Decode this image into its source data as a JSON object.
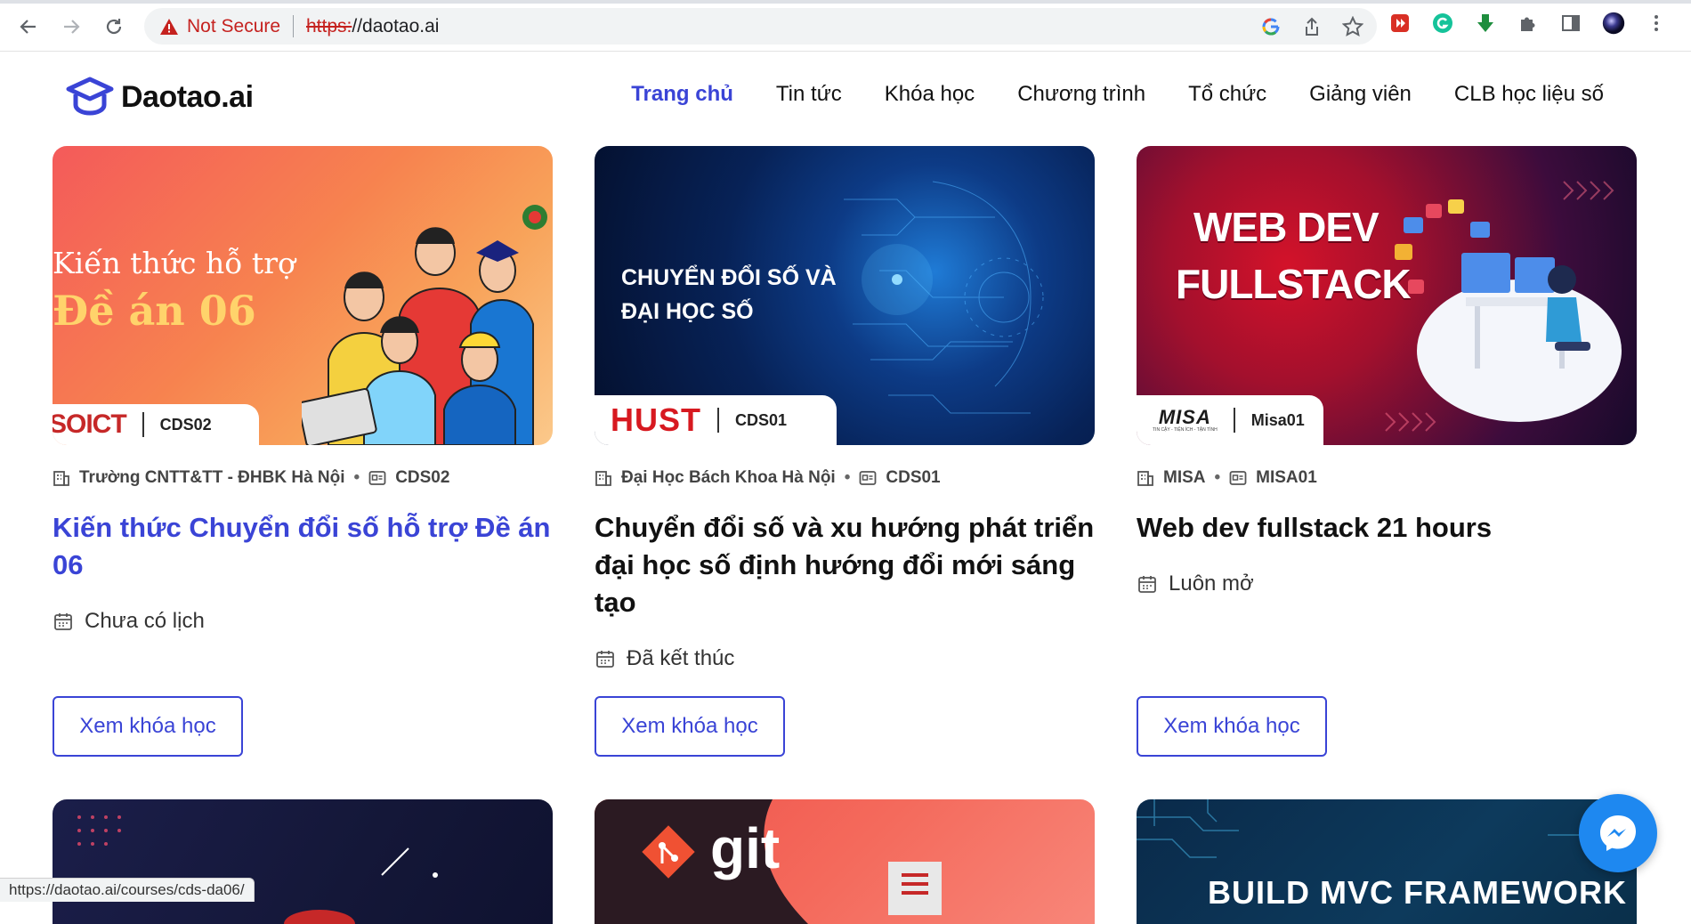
{
  "browser": {
    "security_label": "Not Secure",
    "url_scheme": "https:",
    "url_rest": "//daotao.ai"
  },
  "header": {
    "logo_text": "Daotao.ai",
    "nav": [
      {
        "label": "Trang chủ",
        "active": true
      },
      {
        "label": "Tin tức"
      },
      {
        "label": "Khóa học"
      },
      {
        "label": "Chương trình"
      },
      {
        "label": "Tổ chức"
      },
      {
        "label": "Giảng viên"
      },
      {
        "label": "CLB học liệu số"
      }
    ]
  },
  "courses": [
    {
      "image_line1": "Kiến thức hỗ trợ",
      "image_line2": "Đề án 06",
      "badge_logo": "SOICT",
      "badge_code": "CDS02",
      "org": "Trường CNTT&TT - ĐHBK Hà Nội",
      "code": "CDS02",
      "title": "Kiến thức Chuyển đổi số hỗ trợ Đề án 06",
      "status": "Chưa có lịch",
      "button": "Xem khóa học"
    },
    {
      "image_line1": "CHUYỂN ĐỔI SỐ VÀ",
      "image_line2": "ĐẠI HỌC SỐ",
      "badge_logo": "HUST",
      "badge_code": "CDS01",
      "org": "Đại Học Bách Khoa Hà Nội",
      "code": "CDS01",
      "title": "Chuyển đổi số và xu hướng phát triển đại học số định hướng đổi mới sáng tạo",
      "status": "Đã kết thúc",
      "button": "Xem khóa học"
    },
    {
      "image_line1": "WEB DEV",
      "image_line2": "FULLSTACK",
      "badge_logo": "MISA",
      "badge_sub": "TIN CẬY - TIỆN ÍCH - TẬN TÌNH",
      "badge_code": "Misa01",
      "org": "MISA",
      "code": "MISA01",
      "title": "Web dev fullstack 21 hours",
      "status": "Luôn mở",
      "button": "Xem khóa học"
    }
  ],
  "bottom_row": {
    "git_text": "git",
    "mvc_text": "BUILD MVC FRAMEWORK"
  },
  "statusbar_url": "https://daotao.ai/courses/cds-da06/",
  "colors": {
    "accent": "#3a44d6",
    "messenger": "#1e88f0"
  }
}
